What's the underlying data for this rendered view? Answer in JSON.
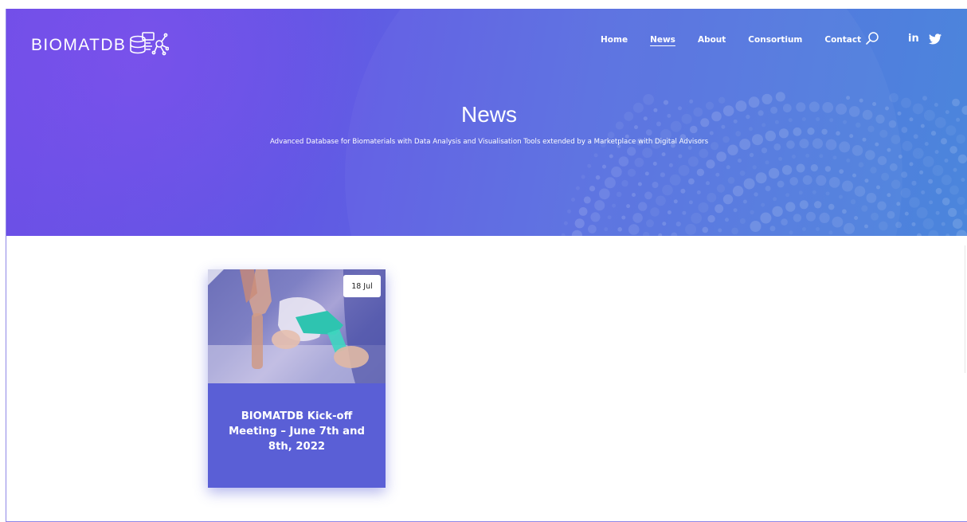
{
  "brand": {
    "name": "BIOMATDB",
    "logo_icon": "database-network-icon"
  },
  "nav": {
    "items": [
      {
        "label": "Home",
        "active": false
      },
      {
        "label": "News",
        "active": true
      },
      {
        "label": "About",
        "active": false
      },
      {
        "label": "Consortium",
        "active": false
      },
      {
        "label": "Contact",
        "active": false
      }
    ],
    "search_icon": "search-icon",
    "social": {
      "linkedin": "in",
      "twitter_icon": "twitter-icon"
    }
  },
  "hero": {
    "title": "News",
    "subtitle": "Advanced Database for Biomaterials with Data Analysis and Visualisation Tools extended by a Marketplace with Digital Advisors"
  },
  "posts": [
    {
      "date": "18 Jul",
      "title": "BIOMATDB Kick-off Meeting – June 7th and 8th, 2022",
      "image": "knee-model-photo"
    }
  ],
  "colors": {
    "hero_start": "#6c4fe6",
    "hero_end": "#4b86dc",
    "card_bg": "#5a5fd6"
  }
}
